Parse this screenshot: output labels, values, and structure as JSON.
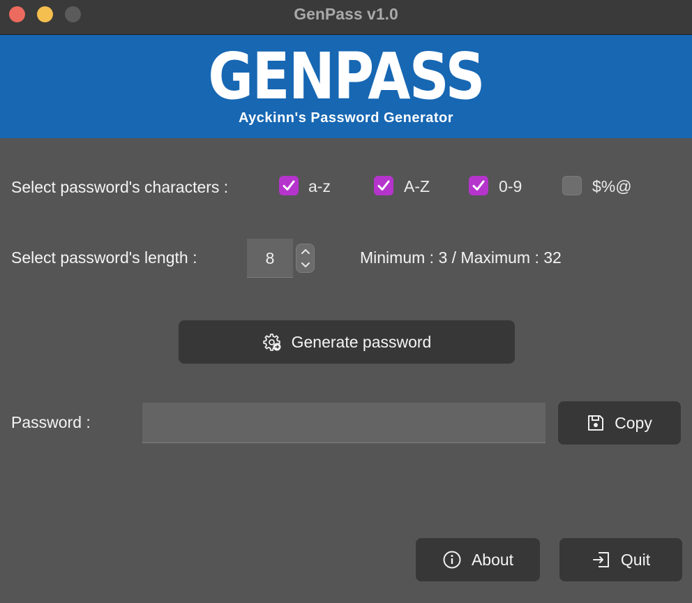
{
  "window": {
    "title": "GenPass v1.0"
  },
  "banner": {
    "logo": "GENPASS",
    "subtitle": "Ayckinn's Password Generator"
  },
  "characters": {
    "label": "Select password's characters :",
    "options": [
      {
        "label": "a-z",
        "checked": true
      },
      {
        "label": "A-Z",
        "checked": true
      },
      {
        "label": "0-9",
        "checked": true
      },
      {
        "label": "$%@",
        "checked": false
      }
    ]
  },
  "length": {
    "label": "Select password's length :",
    "value": "8",
    "range_text": "Minimum : 3 / Maximum : 32"
  },
  "generate_button": {
    "label": "Generate password",
    "icon": "gear-icon"
  },
  "password": {
    "label": "Password :",
    "value": "",
    "placeholder": ""
  },
  "copy_button": {
    "label": "Copy",
    "icon": "save-icon"
  },
  "about_button": {
    "label": "About",
    "icon": "info-icon"
  },
  "quit_button": {
    "label": "Quit",
    "icon": "exit-icon"
  },
  "colors": {
    "banner": "#1767b3",
    "checkbox_checked": "#b534cc",
    "background": "#555555",
    "button": "#373737"
  }
}
